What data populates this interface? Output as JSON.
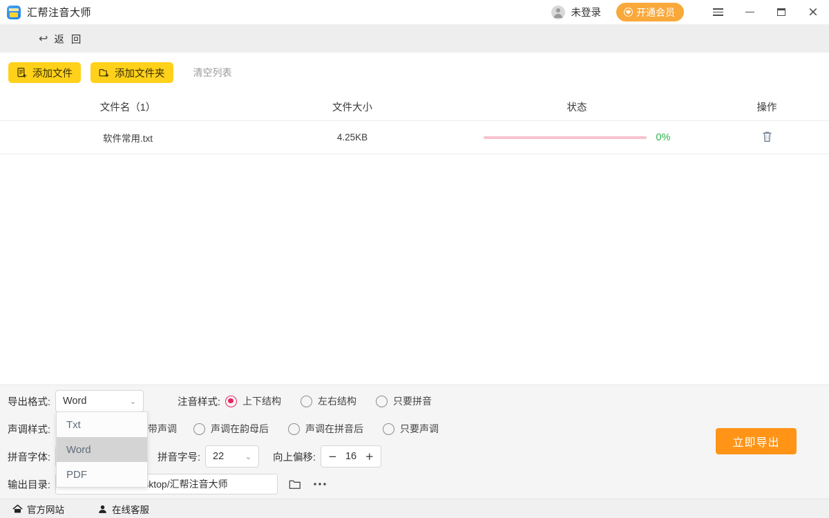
{
  "titlebar": {
    "app_name": "汇帮注音大师",
    "app_icon": "app-logo-icon",
    "user_label": "未登录",
    "vip_label": "开通会员",
    "menu_icon": "hamburger-menu-icon",
    "minimize_icon": "minimize-icon",
    "maximize_icon": "maximize-icon",
    "close_icon": "close-icon",
    "close_glyph": "×"
  },
  "backbar": {
    "label": "返 回",
    "arrow": "↩"
  },
  "toolbar": {
    "add_file": "添加文件",
    "add_folder": "添加文件夹",
    "clear_list": "清空列表",
    "accent": "#ffd11a"
  },
  "table": {
    "headers": [
      "文件名（1）",
      "文件大小",
      "状态",
      "操作"
    ],
    "rows": [
      {
        "name": "软件常用.txt",
        "size": "4.25KB",
        "progress_percent": "0%",
        "progress_value": 0,
        "action_icon": "trash-icon"
      }
    ],
    "progress_track_color": "#f7c3ce",
    "progress_text_color": "#2bb34a"
  },
  "settings": {
    "export_format": {
      "label": "导出格式:",
      "value": "Word",
      "options": [
        "Txt",
        "Word",
        "PDF"
      ],
      "open": true
    },
    "annotation_style": {
      "label": "注音样式:",
      "options": [
        "上下结构",
        "左右结构",
        "只要拼音"
      ],
      "selected": "上下结构",
      "accent": "#e8255f"
    },
    "tone_style": {
      "label": "声调样式:",
      "options": [
        "不带声调",
        "声调在韵母后",
        "声调在拼音后",
        "只要声调"
      ],
      "selected": "不带声调"
    },
    "pinyin_font": {
      "label": "拼音字体:",
      "value": ""
    },
    "pinyin_size": {
      "label": "拼音字号:",
      "value": "22"
    },
    "offset_up": {
      "label": "向上偏移:",
      "value": "16",
      "minus": "−",
      "plus": "+"
    },
    "output_dir": {
      "label": "输出目录:",
      "value": "C:/Users/admin/Desktop/汇帮注音大师",
      "browse_icon": "folder-open-icon",
      "more_icon": "more-horizontal-icon"
    },
    "export_button": "立即导出",
    "export_button_color": "#ff9416"
  },
  "statusbar": {
    "links": [
      {
        "label": "官方网站",
        "icon": "home-icon"
      },
      {
        "label": "在线客服",
        "icon": "customer-service-icon"
      }
    ]
  }
}
